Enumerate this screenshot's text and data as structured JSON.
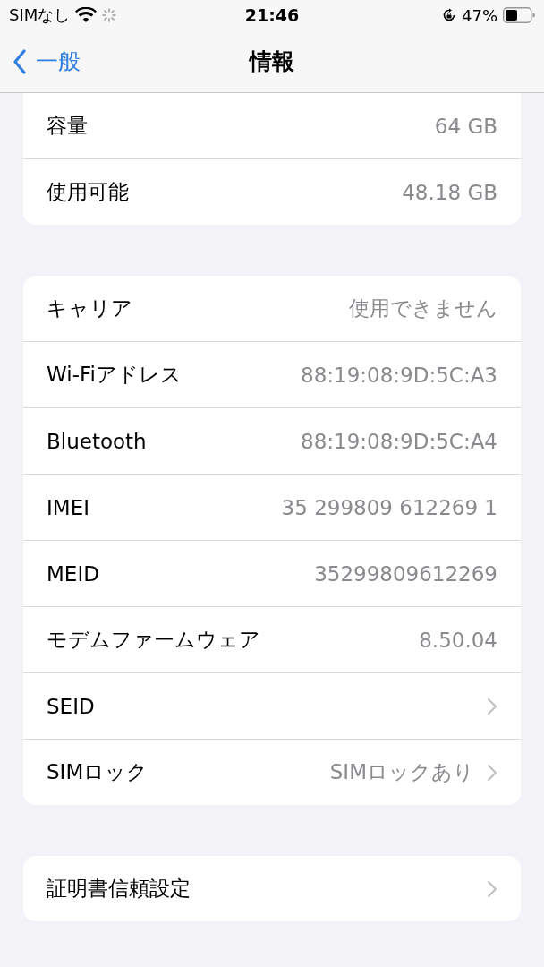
{
  "status_bar": {
    "carrier": "SIMなし",
    "time": "21:46",
    "battery_percent": "47%"
  },
  "nav": {
    "back": "一般",
    "title": "情報"
  },
  "groups": [
    {
      "rows": [
        {
          "label": "容量",
          "value": "64 GB"
        },
        {
          "label": "使用可能",
          "value": "48.18 GB"
        }
      ]
    },
    {
      "rows": [
        {
          "label": "キャリア",
          "value": "使用できません"
        },
        {
          "label": "Wi-Fiアドレス",
          "value": "88:19:08:9D:5C:A3"
        },
        {
          "label": "Bluetooth",
          "value": "88:19:08:9D:5C:A4"
        },
        {
          "label": "IMEI",
          "value": "35 299809 612269 1"
        },
        {
          "label": "MEID",
          "value": "35299809612269"
        },
        {
          "label": "モデムファームウェア",
          "value": "8.50.04"
        },
        {
          "label": "SEID",
          "disclosure": true
        },
        {
          "label": "SIMロック",
          "value": "SIMロックあり",
          "disclosure": true
        }
      ]
    },
    {
      "rows": [
        {
          "label": "証明書信頼設定",
          "disclosure": true
        }
      ]
    }
  ]
}
